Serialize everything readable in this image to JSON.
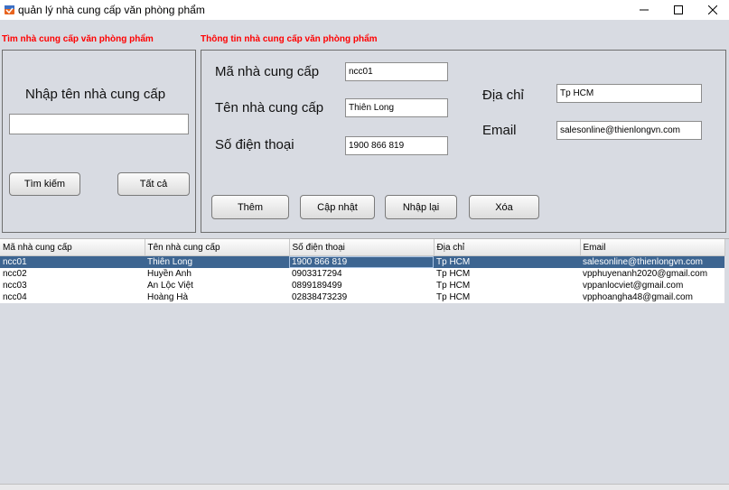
{
  "window": {
    "title": "quản lý nhà cung cấp văn phòng phẩm",
    "controls": [
      "minimize",
      "maximize",
      "close"
    ]
  },
  "search_panel": {
    "section_title": "Tìm nhà cung cấp văn phòng phẩm",
    "prompt": "Nhập tên nhà cung cấp",
    "input_value": "",
    "search_button": "Tìm kiếm",
    "all_button": "Tất cả"
  },
  "info_panel": {
    "section_title": "Thông tin nhà cung cấp văn phòng phẩm",
    "code_label": "Mã nhà cung cấp",
    "code_value": "ncc01",
    "name_label": "Tên nhà cung cấp",
    "name_value": "Thiên Long",
    "phone_label": "Số điện thoại",
    "phone_value": "1900 866 819",
    "address_label": "Địa chỉ",
    "address_value": "Tp HCM",
    "email_label": "Email",
    "email_value": "salesonline@thienlongvn.com",
    "add_button": "Thêm",
    "update_button": "Cập nhật",
    "reset_button": "Nhập lại",
    "delete_button": "Xóa"
  },
  "table": {
    "columns": [
      "Mã nhà cung cấp",
      "Tên nhà cung cấp",
      "Số điện thoại",
      "Địa chỉ",
      "Email"
    ],
    "rows": [
      [
        "ncc01",
        "Thiên Long",
        "1900 866 819",
        "Tp HCM",
        "salesonline@thienlongvn.com"
      ],
      [
        "ncc02",
        "Huyền Anh",
        "0903317294",
        "Tp HCM",
        "vpphuyenanh2020@gmail.com"
      ],
      [
        "ncc03",
        "An Lộc Việt",
        "0899189499",
        "Tp HCM",
        "vppanlocviet@gmail.com"
      ],
      [
        "ncc04",
        "Hoàng Hà",
        "02838473239",
        "Tp HCM",
        "vpphoangha48@gmail.com"
      ]
    ],
    "selected_row": 0
  },
  "colors": {
    "section_title": "#ff0000",
    "selection": "#3d6591",
    "background": "#d8dbe2"
  }
}
